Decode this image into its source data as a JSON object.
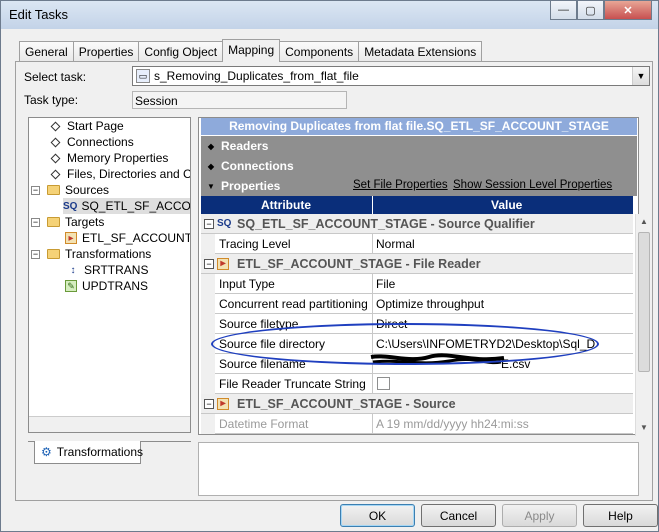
{
  "window": {
    "title": "Edit Tasks",
    "buttons": {
      "minimize": "—",
      "maximize": "▢",
      "close": "✕"
    }
  },
  "tabs": [
    "General",
    "Properties",
    "Config Object",
    "Mapping",
    "Components",
    "Metadata Extensions"
  ],
  "active_tab": "Mapping",
  "select_task": {
    "label": "Select task:",
    "value": "s_Removing_Duplicates_from_flat_file"
  },
  "task_type": {
    "label": "Task type:",
    "value": "Session"
  },
  "tree": {
    "items": [
      "Start Page",
      "Connections",
      "Memory Properties",
      "Files, Directories and Comm",
      "Sources",
      "SQ_ETL_SF_ACCOUNT",
      "Targets",
      "ETL_SF_ACCOUNT_ST",
      "Transformations",
      "SRTTRANS",
      "UPDTRANS"
    ],
    "sq_prefix": "SQ"
  },
  "bottom_tab": "Transformations",
  "panel_title": "Removing Duplicates from flat file.SQ_ETL_SF_ACCOUNT_STAGE",
  "sections": {
    "readers": "Readers",
    "connections": "Connections",
    "properties": "Properties",
    "set_file_properties": "Set File Properties",
    "show_session_level": "Show Session Level Properties"
  },
  "grid": {
    "headers": {
      "attribute": "Attribute",
      "value": "Value"
    },
    "groups": {
      "sq": "SQ_ETL_SF_ACCOUNT_STAGE - Source Qualifier",
      "reader": "ETL_SF_ACCOUNT_STAGE - File Reader",
      "source": "ETL_SF_ACCOUNT_STAGE - Source",
      "sq_icon": "SQ"
    },
    "rows": {
      "tracing_level": {
        "attr": "Tracing Level",
        "value": "Normal"
      },
      "input_type": {
        "attr": "Input Type",
        "value": "File"
      },
      "concurrent": {
        "attr": "Concurrent read partitioning",
        "value": "Optimize throughput"
      },
      "filetype": {
        "attr": "Source filetype",
        "value": "Direct"
      },
      "directory": {
        "attr": "Source file directory",
        "value": "C:\\Users\\INFOMETRYD2\\Desktop\\Sql_D"
      },
      "filename": {
        "attr": "Source filename",
        "value": "E.csv"
      },
      "truncate": {
        "attr": "File Reader Truncate String ...",
        "value": ""
      },
      "datetime": {
        "attr": "Datetime Format",
        "value": "A  19 mm/dd/yyyy hh24:mi:ss"
      }
    }
  },
  "buttons": {
    "ok": "OK",
    "cancel": "Cancel",
    "apply": "Apply",
    "help": "Help"
  }
}
